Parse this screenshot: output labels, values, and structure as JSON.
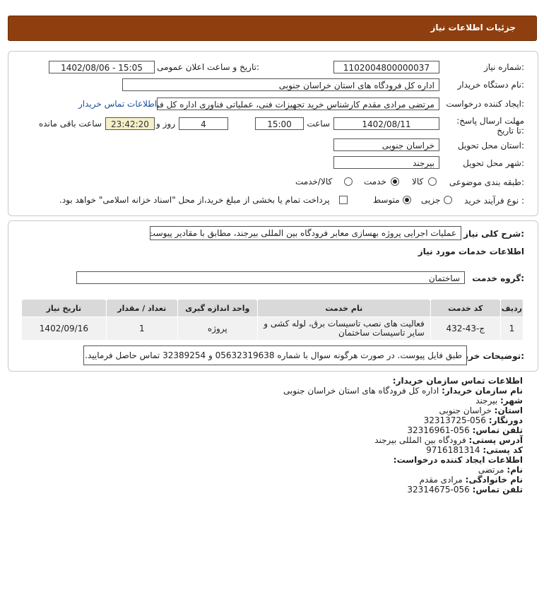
{
  "header": {
    "title": "جزئیات اطلاعات نیاز"
  },
  "form": {
    "need_number_label": "شماره نیاز:",
    "need_number": "1102004800000037",
    "announce_label": "تاریخ و ساعت اعلان عمومی:",
    "announce_value": "1402/08/06 - 15:05",
    "buyer_org_label": "نام دستگاه خریدار:",
    "buyer_org": "اداره کل فرودگاه های استان خراسان جنوبی",
    "creator_label": "ایجاد کننده درخواست:",
    "creator": "مرتضی مرادی مقدم کارشناس خرید تجهیزات فنی، عملیاتی فناوری اداره کل فرودگاه",
    "contact_link": "اطلاعات تماس خریدار",
    "deadline_label": "مهلت ارسال پاسخ: تا تاریخ:",
    "deadline_date": "1402/08/11",
    "time_label": "ساعت",
    "deadline_time": "15:00",
    "days_value": "4",
    "days_label": "روز و",
    "remaining_time": "23:42:20",
    "remaining_label": "ساعت باقی مانده",
    "province_label": "استان محل تحویل:",
    "province": "خراسان جنوبی",
    "city_label": "شهر محل تحویل:",
    "city": "بیرجند",
    "category_label": "طبقه بندی موضوعی:",
    "category_options": [
      "کالا",
      "خدمت",
      "کالا/خدمت"
    ],
    "category_selected": "خدمت",
    "process_label": "نوع فرآیند خرید :",
    "process_options": [
      "جزیی",
      "متوسط"
    ],
    "process_selected": "متوسط",
    "payment_note": "پرداخت تمام یا بخشی از مبلغ خرید،از محل \"اسناد خزانه اسلامی\" خواهد بود."
  },
  "summary": {
    "label": "شرح کلی نیاز:",
    "value": "عملیات اجرایی پروژه بهسازی معابر فرودگاه بین المللی بیرجند، مطابق با مقادیر پیوست"
  },
  "services": {
    "section_title": "اطلاعات خدمات مورد نیاز",
    "group_label": "گروه خدمت:",
    "group_value": "ساختمان",
    "columns": [
      "ردیف",
      "کد خدمت",
      "نام خدمت",
      "واحد اندازه گیری",
      "تعداد / مقدار",
      "تاریخ نیاز"
    ],
    "rows": [
      {
        "row": "1",
        "code": "ج-43-432",
        "name": "فعالیت های نصب تاسیسات برق، لوله کشی و سایر تاسیسات ساختمان",
        "unit": "پروژه",
        "qty": "1",
        "date": "1402/09/16"
      }
    ]
  },
  "notes": {
    "label": "توضیحات خریدار:",
    "value": "طبق فایل پیوست. در صورت هرگونه سوال با شماره 05632319638 و 32389254 تماس حاصل فرمایید."
  },
  "buyer_contact": {
    "heading": "اطلاعات تماس سازمان خریدار:",
    "org_label": "نام سازمان خریدار:",
    "org": "اداره کل فرودگاه های استان خراسان جنوبی",
    "city_label": "شهر:",
    "city": "بیرجند",
    "province_label": "استان:",
    "province": "خراسان جنوبی",
    "fax_label": "دورنگار:",
    "fax": "056-32313725",
    "phone_label": "تلفن تماس:",
    "phone": "056-32316961",
    "address_label": "آدرس پستی:",
    "address": "فرودگاه بین المللی بیرجند",
    "postal_label": "کد پستی:",
    "postal": "9716181314"
  },
  "creator_contact": {
    "heading": "اطلاعات ایجاد کننده درخواست:",
    "name_label": "نام:",
    "name": "مرتضی",
    "family_label": "نام خانوادگی:",
    "family": "مرادی مقدم",
    "phone_label": "تلفن تماس:",
    "phone": "056-32314675"
  }
}
